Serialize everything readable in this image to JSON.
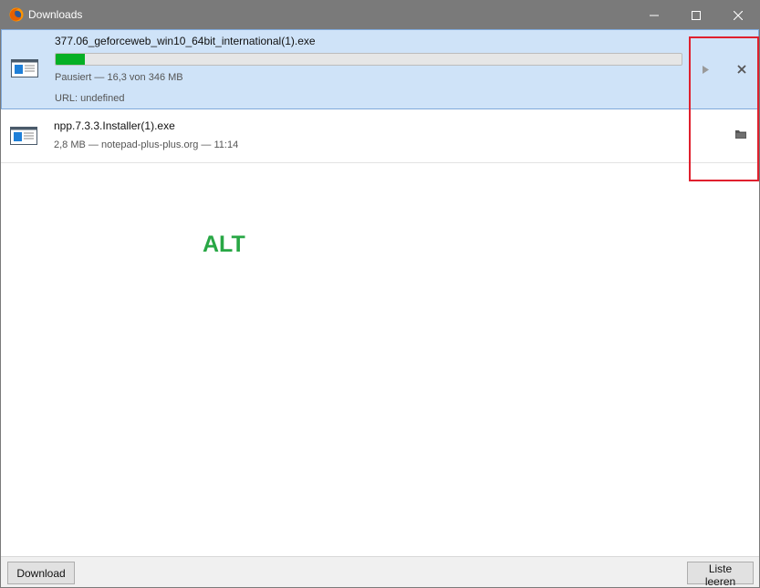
{
  "window": {
    "title": "Downloads",
    "app_icon": "firefox-icon",
    "controls": [
      "minimize-icon",
      "maximize-icon",
      "close-icon"
    ]
  },
  "downloads": [
    {
      "filename": "377.06_geforceweb_win10_64bit_international(1).exe",
      "status": "Pausiert —  16,3 von 346 MB",
      "url": "URL: undefined",
      "progress_percent": 4.7,
      "selected": true,
      "actions": [
        "play-icon",
        "cancel-icon"
      ]
    },
    {
      "filename": "npp.7.3.3.Installer(1).exe",
      "status": "2,8 MB — notepad-plus-plus.org — 11:14",
      "actions": [
        "folder-icon"
      ]
    }
  ],
  "annotation": {
    "text": "ALT",
    "color": "#28a745"
  },
  "highlight_color": "#e0202e",
  "footer": {
    "download_label": "Download",
    "clear_label": "Liste leeren"
  },
  "colors": {
    "titlebar": "#7a7a7a",
    "selected_row": "#cfe3f8",
    "progress": "#06b025"
  }
}
